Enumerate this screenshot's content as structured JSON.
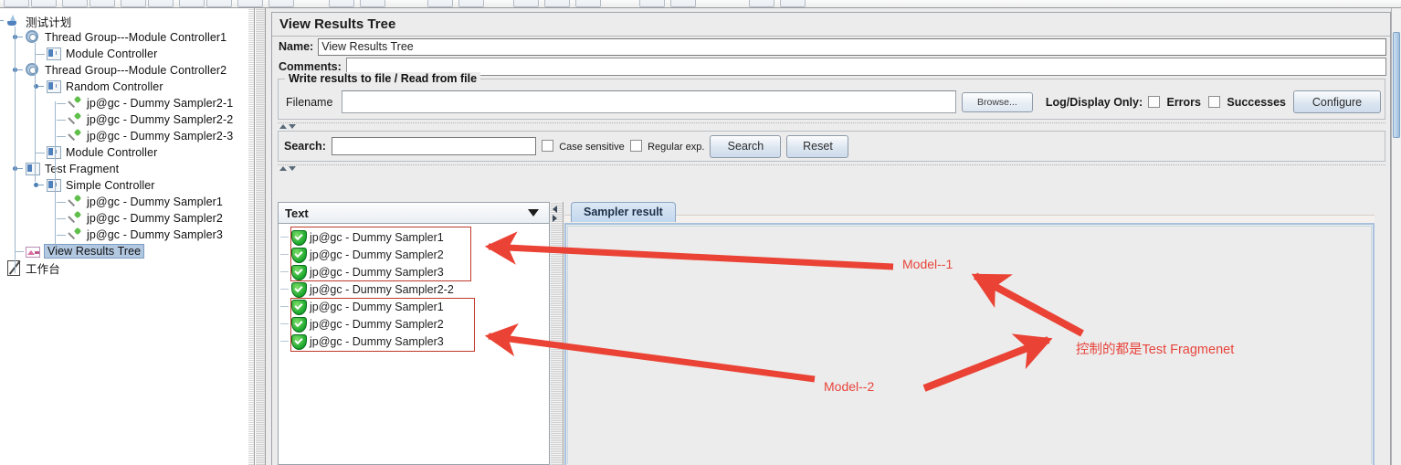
{
  "app": {
    "window_title": "JMeter - View Results Tree"
  },
  "tree": {
    "nodes": [
      {
        "label": "测试计划",
        "icon": "test-plan-icon",
        "indent": 0,
        "selected": false
      },
      {
        "label": "Thread Group---Module Controller1",
        "icon": "thread-group-icon",
        "indent": 1,
        "selected": false
      },
      {
        "label": "Module Controller",
        "icon": "module-controller-icon",
        "indent": 2,
        "selected": false
      },
      {
        "label": "Thread Group---Module Controller2",
        "icon": "thread-group-icon",
        "indent": 1,
        "selected": false
      },
      {
        "label": "Random Controller",
        "icon": "random-controller-icon",
        "indent": 2,
        "selected": false
      },
      {
        "label": "jp@gc - Dummy Sampler2-1",
        "icon": "dummy-sampler-icon",
        "indent": 3,
        "selected": false
      },
      {
        "label": "jp@gc - Dummy Sampler2-2",
        "icon": "dummy-sampler-icon",
        "indent": 3,
        "selected": false
      },
      {
        "label": "jp@gc - Dummy Sampler2-3",
        "icon": "dummy-sampler-icon",
        "indent": 3,
        "selected": false
      },
      {
        "label": "Module Controller",
        "icon": "module-controller-icon",
        "indent": 2,
        "selected": false
      },
      {
        "label": "Test Fragment",
        "icon": "test-fragment-icon",
        "indent": 1,
        "selected": false
      },
      {
        "label": "Simple Controller",
        "icon": "simple-controller-icon",
        "indent": 2,
        "selected": false
      },
      {
        "label": "jp@gc - Dummy Sampler1",
        "icon": "dummy-sampler-icon",
        "indent": 3,
        "selected": false
      },
      {
        "label": "jp@gc - Dummy Sampler2",
        "icon": "dummy-sampler-icon",
        "indent": 3,
        "selected": false
      },
      {
        "label": "jp@gc - Dummy Sampler3",
        "icon": "dummy-sampler-icon",
        "indent": 3,
        "selected": false
      },
      {
        "label": "View Results Tree",
        "icon": "view-results-tree-icon",
        "indent": 1,
        "selected": true
      },
      {
        "label": "工作台",
        "icon": "workbench-icon",
        "indent": 0,
        "selected": false
      }
    ]
  },
  "panel": {
    "title": "View Results Tree",
    "name_label": "Name:",
    "name_value": "View Results Tree",
    "comments_label": "Comments:",
    "comments_value": "",
    "file_group_title": "Write results to file / Read from file",
    "filename_label": "Filename",
    "filename_value": "",
    "browse_label": "Browse...",
    "log_display_label": "Log/Display Only:",
    "errors_label": "Errors",
    "errors_checked": false,
    "successes_label": "Successes",
    "successes_checked": false,
    "configure_label": "Configure"
  },
  "search": {
    "label": "Search:",
    "value": "",
    "case_sensitive_label": "Case sensitive",
    "case_sensitive_checked": false,
    "regex_label": "Regular exp.",
    "regex_checked": false,
    "search_button": "Search",
    "reset_button": "Reset"
  },
  "results": {
    "renderer_selected": "Text",
    "items": [
      {
        "label": "jp@gc - Dummy Sampler1",
        "status": "success"
      },
      {
        "label": "jp@gc - Dummy Sampler2",
        "status": "success"
      },
      {
        "label": "jp@gc - Dummy Sampler3",
        "status": "success"
      },
      {
        "label": "jp@gc - Dummy Sampler2-2",
        "status": "success"
      },
      {
        "label": "jp@gc - Dummy Sampler1",
        "status": "success"
      },
      {
        "label": "jp@gc - Dummy Sampler2",
        "status": "success"
      },
      {
        "label": "jp@gc - Dummy Sampler3",
        "status": "success"
      }
    ]
  },
  "tabs": {
    "items": [
      {
        "label": "Sampler result",
        "active": true
      }
    ]
  },
  "annotations": {
    "highlight_color": "#c0392b",
    "arrow_color": "#ea4335",
    "labels": [
      {
        "text": "Model--1"
      },
      {
        "text": "Model--2"
      },
      {
        "text": "控制的都是Test Fragmenet"
      }
    ]
  }
}
